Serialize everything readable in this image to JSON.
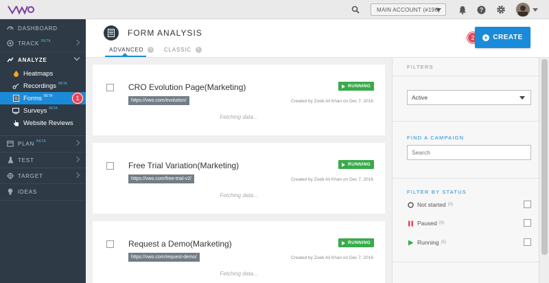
{
  "topbar": {
    "logo_icon": "vwo-logo",
    "account_label": "MAIN ACCOUNT (#196)",
    "icons": [
      "search-icon",
      "bell-icon",
      "help-icon",
      "gear-icon",
      "avatar"
    ]
  },
  "sidebar": {
    "items": [
      {
        "label": "DASHBOARD",
        "icon": "dashboard-icon",
        "beta": ""
      },
      {
        "label": "TRACK",
        "icon": "target-icon",
        "beta": "BETA"
      },
      {
        "label": "ANALYZE",
        "icon": "chart-icon",
        "beta": ""
      },
      {
        "label": "PLAN",
        "icon": "plan-icon",
        "beta": "BETA"
      },
      {
        "label": "TEST",
        "icon": "flask-icon",
        "beta": ""
      },
      {
        "label": "TARGET",
        "icon": "crosshair-icon",
        "beta": ""
      },
      {
        "label": "IDEAS",
        "icon": "lightbulb-icon",
        "beta": ""
      }
    ],
    "analyze_sub": [
      {
        "label": "Heatmaps",
        "icon": "flame-icon",
        "beta": ""
      },
      {
        "label": "Recordings",
        "icon": "recording-icon",
        "beta": "BETA"
      },
      {
        "label": "Forms",
        "icon": "form-icon",
        "beta": "BETA"
      },
      {
        "label": "Surveys",
        "icon": "survey-icon",
        "beta": "BETA"
      },
      {
        "label": "Website Reviews",
        "icon": "hand-icon",
        "beta": ""
      }
    ],
    "markers": {
      "one": "1"
    }
  },
  "header": {
    "title": "FORM ANALYSIS",
    "tabs": [
      {
        "label": "ADVANCED",
        "help": "?"
      },
      {
        "label": "CLASSIC",
        "help": "?"
      }
    ],
    "create_label": "CREATE",
    "create_marker": "2"
  },
  "campaigns": [
    {
      "title": "CRO Evolution Page(Marketing)",
      "url": "https://vwo.com/evolution/",
      "status": "RUNNING",
      "created": "Created by Zoeb Ali Khan on Dec 7, 2016",
      "loading": "Fetching data..."
    },
    {
      "title": "Free Trial Variation(Marketing)",
      "url": "https://vwo.com/free-trial-v2/",
      "status": "RUNNING",
      "created": "Created by Zoeb Ali Khan on Dec 7, 2016",
      "loading": "Fetching data..."
    },
    {
      "title": "Request a Demo(Marketing)",
      "url": "https://vwo.com/request-demo/",
      "status": "RUNNING",
      "created": "Created by Zoeb Ali Khan on Dec 7, 2016",
      "loading": "Fetching data..."
    }
  ],
  "filters": {
    "title": "FILTERS",
    "state_value": "Active",
    "find_title": "FIND A CAMPAIGN",
    "search_placeholder": "Search",
    "status_title": "FILTER BY STATUS",
    "statuses": [
      {
        "label": "Not started",
        "count": "(0)",
        "icon": "circle-icon"
      },
      {
        "label": "Paused",
        "count": "(0)",
        "icon": "pause-icon"
      },
      {
        "label": "Running",
        "count": "(5)",
        "icon": "play-icon"
      }
    ]
  },
  "colors": {
    "accent": "#1a8bd8",
    "sidebar": "#2e3a45",
    "running": "#3aaa4a",
    "marker": "#e0475a",
    "paused": "#e0475a"
  }
}
